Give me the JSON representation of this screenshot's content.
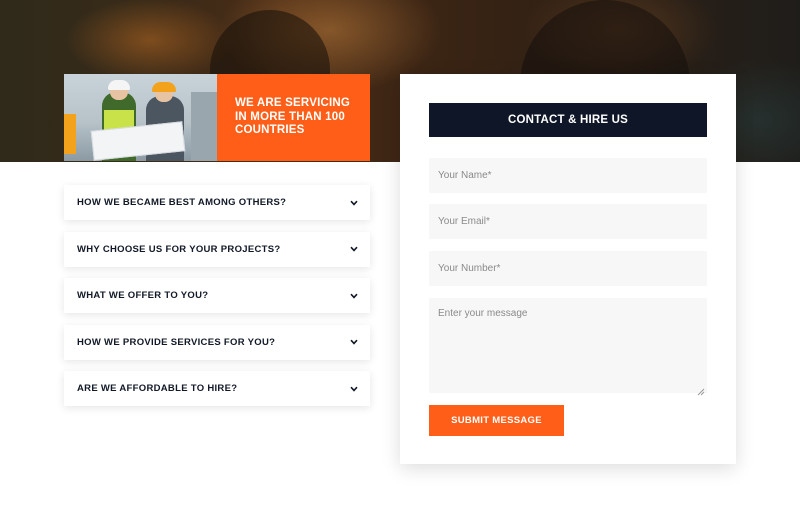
{
  "banner": {
    "text": "WE ARE SERVICING IN MORE THAN 100 COUNTRIES"
  },
  "faq": {
    "items": [
      {
        "label": "HOW WE BECAME BEST AMONG OTHERS?",
        "icon": "chevron-down-icon"
      },
      {
        "label": "WHY CHOOSE US FOR YOUR PROJECTS?",
        "icon": "chevron-down-icon"
      },
      {
        "label": "WHAT WE OFFER TO YOU?",
        "icon": "chevron-down-icon"
      },
      {
        "label": "HOW WE PROVIDE SERVICES FOR YOU?",
        "icon": "chevron-down-icon"
      },
      {
        "label": "ARE WE AFFORDABLE TO HIRE?",
        "icon": "chevron-down-icon"
      }
    ]
  },
  "contact": {
    "title": "CONTACT & HIRE US",
    "name_placeholder": "Your Name*",
    "email_placeholder": "Your Email*",
    "number_placeholder": "Your Number*",
    "message_placeholder": "Enter your message",
    "submit_label": "SUBMIT MESSAGE"
  },
  "colors": {
    "accent": "#fe5e17",
    "header_dark": "#0e1628",
    "field_bg": "#f7f7f7"
  }
}
